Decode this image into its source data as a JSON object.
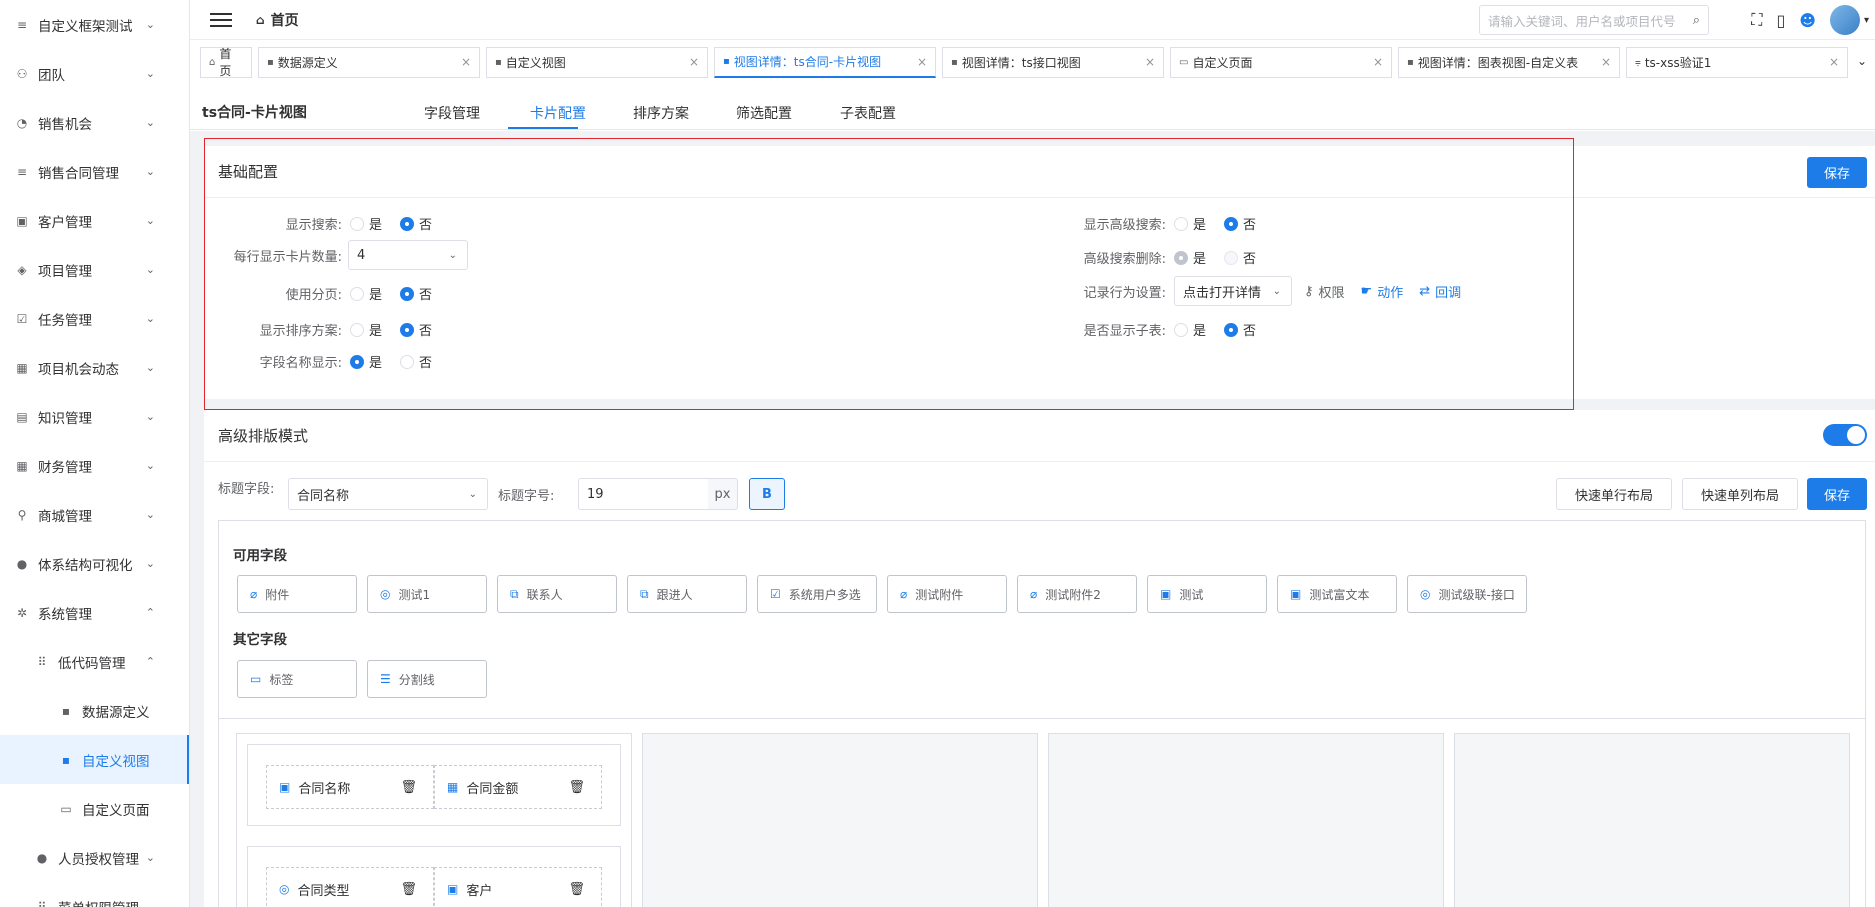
{
  "sidebar": {
    "items": [
      {
        "icon": "menu-icon",
        "glyph": "≡",
        "label": "自定义框架测试",
        "arrow": "⌄"
      },
      {
        "icon": "team-icon",
        "glyph": "⚇",
        "label": "团队",
        "arrow": "⌄"
      },
      {
        "icon": "pie-icon",
        "glyph": "◔",
        "label": "销售机会",
        "arrow": "⌄"
      },
      {
        "icon": "menu-icon",
        "glyph": "≡",
        "label": "销售合同管理",
        "arrow": "⌄"
      },
      {
        "icon": "customer-icon",
        "glyph": "▣",
        "label": "客户管理",
        "arrow": "⌄"
      },
      {
        "icon": "layers-icon",
        "glyph": "◈",
        "label": "项目管理",
        "arrow": "⌄"
      },
      {
        "icon": "task-icon",
        "glyph": "☑",
        "label": "任务管理",
        "arrow": "⌄"
      },
      {
        "icon": "calendar-icon",
        "glyph": "▦",
        "label": "项目机会动态",
        "arrow": "⌄"
      },
      {
        "icon": "book-icon",
        "glyph": "▤",
        "label": "知识管理",
        "arrow": "⌄"
      },
      {
        "icon": "grid-icon",
        "glyph": "▦",
        "label": "财务管理",
        "arrow": "⌄"
      },
      {
        "icon": "shop-icon",
        "glyph": "⚲",
        "label": "商城管理",
        "arrow": "⌄"
      },
      {
        "icon": "user-icon",
        "glyph": "●",
        "label": "体系结构可视化",
        "arrow": "⌄"
      },
      {
        "icon": "gear-icon",
        "glyph": "✲",
        "label": "系统管理",
        "arrow": "⌃"
      }
    ],
    "sub": [
      {
        "icon": "dots-icon",
        "glyph": "⠿",
        "label": "低代码管理",
        "arrow": "⌃",
        "level": 2
      },
      {
        "icon": "datasource-icon",
        "glyph": "▪",
        "label": "数据源定义",
        "arrow": "",
        "level": 3
      },
      {
        "icon": "view-icon",
        "glyph": "▪",
        "label": "自定义视图",
        "arrow": "",
        "level": 3,
        "active": true
      },
      {
        "icon": "page-icon",
        "glyph": "▭",
        "label": "自定义页面",
        "arrow": "",
        "level": 3
      },
      {
        "icon": "person-icon",
        "glyph": "●",
        "label": "人员授权管理",
        "arrow": "⌄",
        "level": 2
      },
      {
        "icon": "dots-icon",
        "glyph": "⠿",
        "label": "菜单权限管理",
        "arrow": "",
        "level": 2
      }
    ]
  },
  "topbar": {
    "breadcrumb": "首页",
    "search_placeholder": "请输入关键词、用户名或项目代号"
  },
  "tabs": [
    {
      "label": "首页",
      "icon": "home-icon",
      "glyph": "⌂",
      "closable": false
    },
    {
      "label": "数据源定义",
      "icon": "doc-icon",
      "glyph": "▪",
      "closable": true
    },
    {
      "label": "自定义视图",
      "icon": "doc-icon",
      "glyph": "▪",
      "closable": true
    },
    {
      "label": "视图详情：ts合同-卡片视图",
      "icon": "doc-icon",
      "glyph": "▪",
      "closable": true,
      "active": true
    },
    {
      "label": "视图详情：ts接口视图",
      "icon": "doc-icon",
      "glyph": "▪",
      "closable": true
    },
    {
      "label": "自定义页面",
      "icon": "page-icon",
      "glyph": "▭",
      "closable": true
    },
    {
      "label": "视图详情：图表视图-自定义表",
      "icon": "doc-icon",
      "glyph": "▪",
      "closable": true
    },
    {
      "label": "ts-xss验证1",
      "icon": "filter-icon",
      "glyph": "⩦",
      "closable": true
    }
  ],
  "view": {
    "title": "ts合同-卡片视图",
    "tabs": [
      "字段管理",
      "卡片配置",
      "排序方案",
      "筛选配置",
      "子表配置"
    ],
    "active_tab": "卡片配置"
  },
  "basic": {
    "title": "基础配置",
    "save": "保存",
    "yes": "是",
    "no": "否",
    "show_search": "显示搜索:",
    "cards_per_row": "每行显示卡片数量:",
    "cards_per_row_value": "4",
    "use_paging": "使用分页:",
    "show_sort": "显示排序方案:",
    "field_name_show": "字段名称显示:",
    "show_adv_search": "显示高级搜索:",
    "adv_search_delete": "高级搜索删除:",
    "record_action": "记录行为设置:",
    "record_action_value": "点击打开详情",
    "permission": "权限",
    "action": "动作",
    "callback": "回调",
    "show_subtable": "是否显示子表:"
  },
  "advanced": {
    "title": "高级排版模式",
    "title_field_label": "标题字段:",
    "title_field_value": "合同名称",
    "title_size_label": "标题字号:",
    "title_size_value": "19",
    "px": "px",
    "bold": "B",
    "quick_row": "快速单行布局",
    "quick_col": "快速单列布局",
    "save": "保存",
    "available_title": "可用字段",
    "other_title": "其它字段",
    "available": [
      {
        "label": "附件",
        "icon": "attachment-icon",
        "glyph": "⌀"
      },
      {
        "label": "测试1",
        "icon": "radio-icon",
        "glyph": "◎"
      },
      {
        "label": "联系人",
        "icon": "contact-icon",
        "glyph": "⧉"
      },
      {
        "label": "跟进人",
        "icon": "contact-icon",
        "glyph": "⧉"
      },
      {
        "label": "系统用户多选",
        "icon": "checkbox-icon",
        "glyph": "☑"
      },
      {
        "label": "测试附件",
        "icon": "attachment-icon",
        "glyph": "⌀"
      },
      {
        "label": "测试附件2",
        "icon": "attachment-icon",
        "glyph": "⌀"
      },
      {
        "label": "测试",
        "icon": "text-icon",
        "glyph": "▣"
      },
      {
        "label": "测试富文本",
        "icon": "text-icon",
        "glyph": "▣"
      },
      {
        "label": "测试级联-接口",
        "icon": "radio-icon",
        "glyph": "◎"
      }
    ],
    "other": [
      {
        "label": "标签",
        "icon": "tag-icon",
        "glyph": "▭"
      },
      {
        "label": "分割线",
        "icon": "divider-icon",
        "glyph": "☰"
      }
    ],
    "card_fields": [
      [
        {
          "label": "合同名称",
          "icon": "text-icon",
          "glyph": "▣"
        },
        {
          "label": "合同金额",
          "icon": "number-icon",
          "glyph": "▦"
        }
      ],
      [
        {
          "label": "合同类型",
          "icon": "radio-icon",
          "glyph": "◎"
        },
        {
          "label": "客户",
          "icon": "text-icon",
          "glyph": "▣"
        }
      ]
    ]
  }
}
